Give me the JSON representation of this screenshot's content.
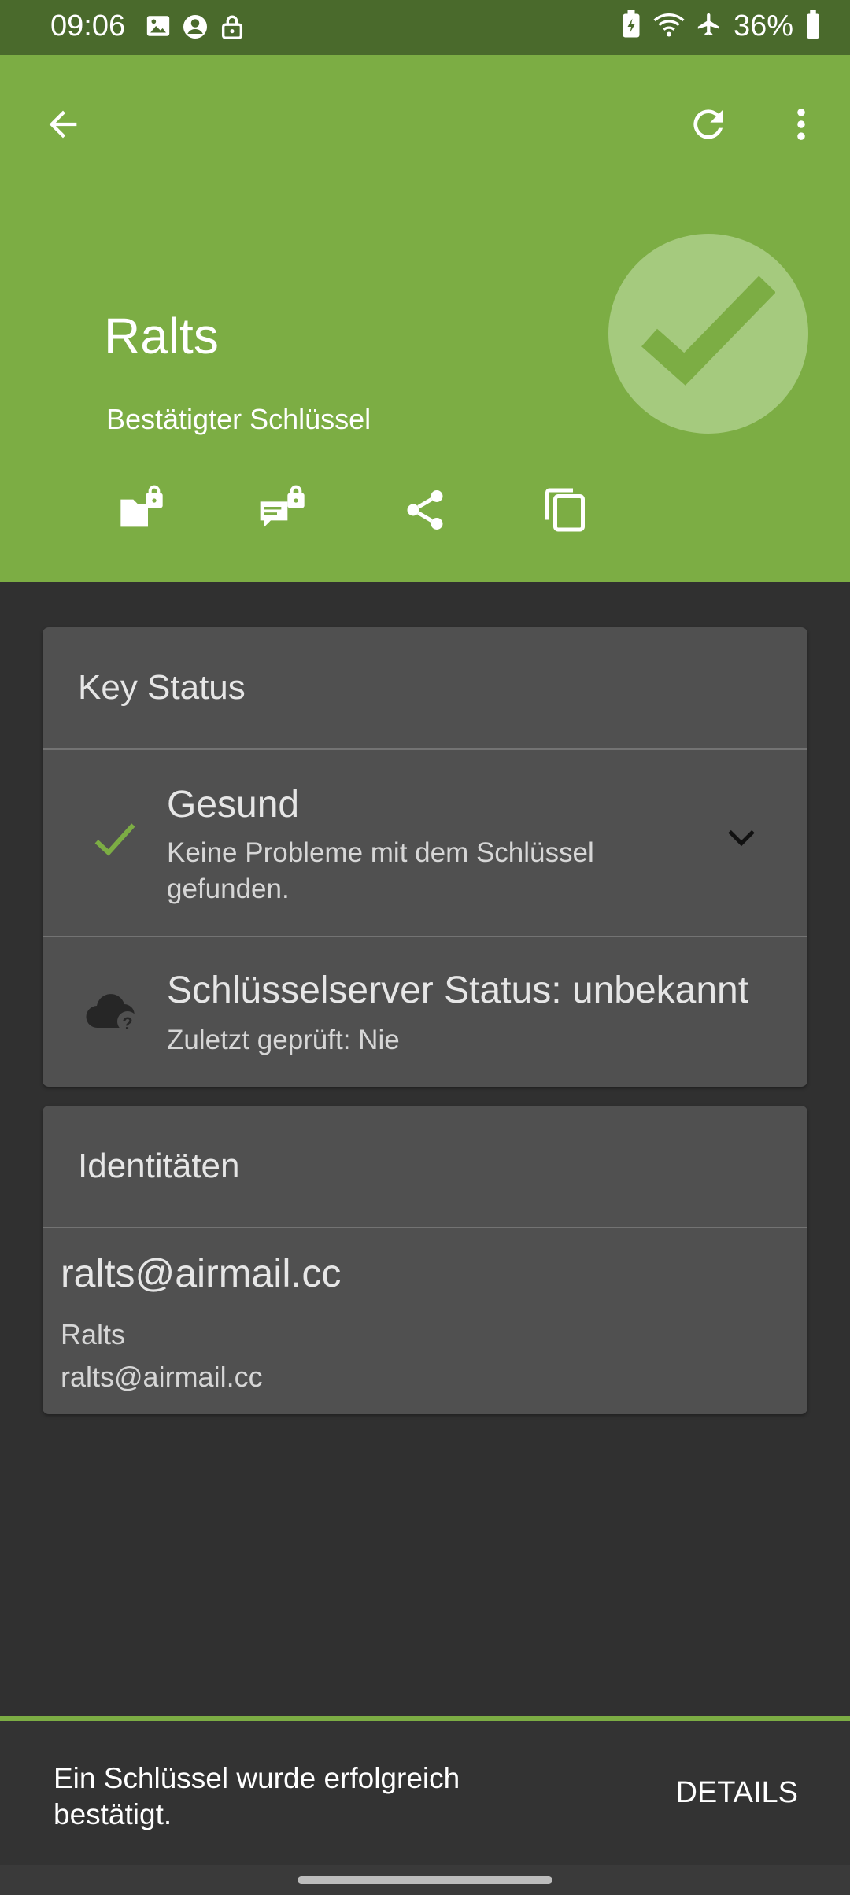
{
  "status_bar": {
    "time": "09:06",
    "battery": "36%",
    "icons_left": [
      "image-icon",
      "account-icon",
      "lock-icon"
    ],
    "icons_right": [
      "battery-saver-icon",
      "wifi-icon",
      "airplane-icon",
      "battery-icon"
    ]
  },
  "header": {
    "key_name": "Ralts",
    "key_subtitle": "Bestätigter Schlüssel",
    "color": "#7cad44",
    "actions": [
      "encrypt-files-icon",
      "encrypt-text-icon",
      "share-icon",
      "copy-icon"
    ]
  },
  "key_status": {
    "title": "Key Status",
    "rows": [
      {
        "title": "Gesund",
        "subtitle": "Keine Probleme mit dem Schlüssel gefunden.",
        "icon": "check-icon"
      },
      {
        "title": "Schlüsselserver Status: unbekannt",
        "subtitle": "Zuletzt geprüft: Nie",
        "icon": "cloud-question-icon"
      }
    ]
  },
  "identities": {
    "title": "Identitäten",
    "items": [
      {
        "primary": "ralts@airmail.cc",
        "name": "Ralts",
        "email": "ralts@airmail.cc"
      }
    ]
  },
  "snackbar": {
    "message": "Ein Schlüssel wurde erfolgreich bestätigt.",
    "action": "DETAILS"
  }
}
